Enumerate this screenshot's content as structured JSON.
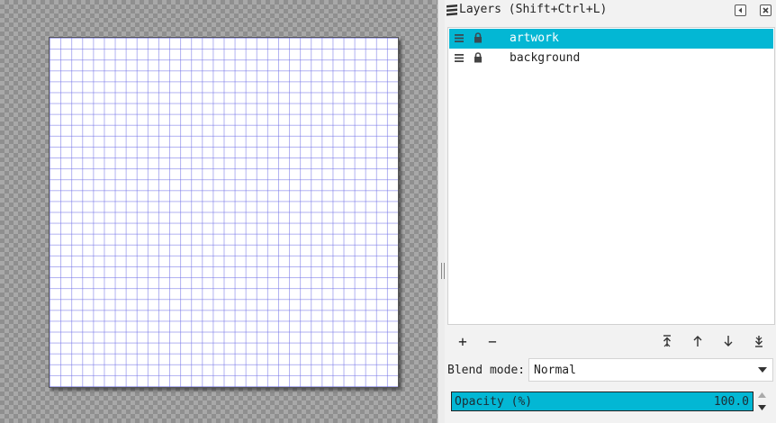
{
  "panel": {
    "title": "Layers (Shift+Ctrl+L)",
    "icon": "layers-icon"
  },
  "layers": [
    {
      "name": "artwork",
      "selected": true,
      "visible": true,
      "locked": true
    },
    {
      "name": "background",
      "selected": false,
      "visible": true,
      "locked": true
    }
  ],
  "toolbar": {
    "add": "+",
    "remove": "−",
    "icons": [
      "add-layer-icon",
      "remove-layer-icon",
      "raise-to-top-icon",
      "raise-icon",
      "lower-icon",
      "lower-to-bottom-icon"
    ]
  },
  "blend": {
    "label": "Blend mode:",
    "value": "Normal"
  },
  "opacity": {
    "label": "Opacity (%)",
    "value": "100.0",
    "level": 1.0
  },
  "colors": {
    "accent": "#03b7d4",
    "grid": "#6e6ee6",
    "checker_dark": "#8f8f8f",
    "checker_light": "#a8a8a8"
  }
}
